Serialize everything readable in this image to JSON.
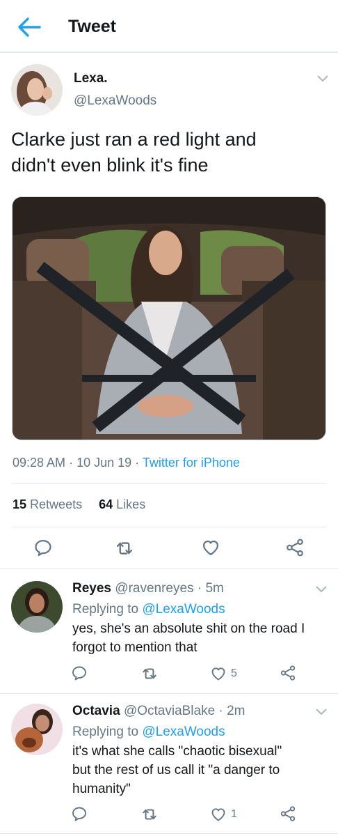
{
  "header": {
    "title": "Tweet"
  },
  "tweet": {
    "name": "Lexa.",
    "handle": "@LexaWoods",
    "text_line1": "Clarke just ran a red light and",
    "text_line2": "didn't even blink it's fine",
    "time": "09:28 AM",
    "date": "10 Jun 19",
    "source": "Twitter for iPhone",
    "retweets_count": "15",
    "retweets_label": "Retweets",
    "likes_count": "64",
    "likes_label": "Likes"
  },
  "replies": [
    {
      "name": "Reyes",
      "handle": "@ravenreyes",
      "time": "5m",
      "replying_prefix": "Replying to",
      "replying_to": "@LexaWoods",
      "line1": "yes, she's an absolute shit on the road I",
      "line2": "forgot to mention that",
      "line3": "",
      "like_count": "5"
    },
    {
      "name": "Octavia",
      "handle": "@OctaviaBlake",
      "time": "2m",
      "replying_prefix": "Replying to",
      "replying_to": "@LexaWoods",
      "line1": "it's what she calls \"chaotic bisexual\"",
      "line2": "but the rest of us call it \"a danger to",
      "line3": "humanity\"",
      "like_count": "1"
    }
  ],
  "icons": {
    "back": "back-arrow-icon",
    "reply": "reply-icon",
    "retweet": "retweet-icon",
    "like": "heart-icon",
    "share": "share-icon",
    "more": "chevron-down-icon"
  },
  "colors": {
    "accent": "#1da1f2",
    "secondary_text": "#657786",
    "primary_text": "#14171a",
    "divider": "#e1e8ed"
  }
}
